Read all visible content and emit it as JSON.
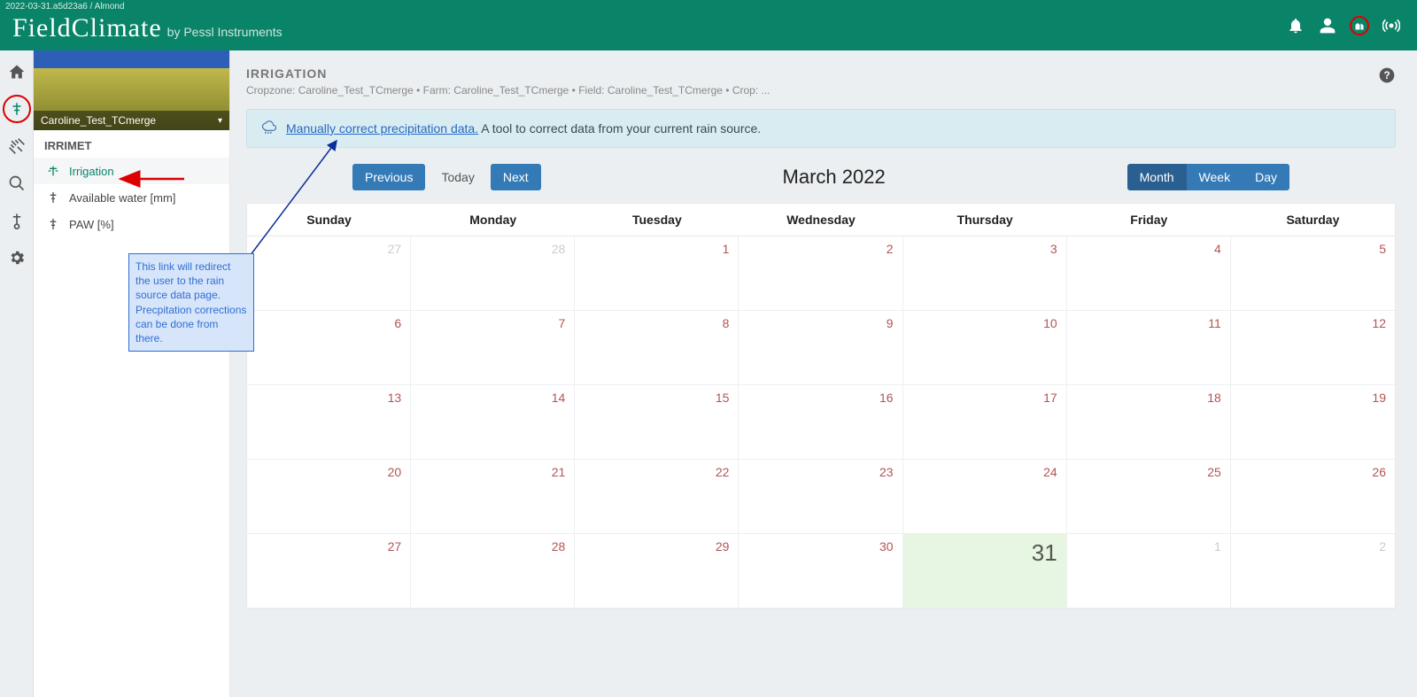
{
  "version": "2022-03-31.a5d23a6 / Almond",
  "brand": {
    "name": "FieldClimate",
    "by": "by Pessl Instruments"
  },
  "hero": {
    "title": "Caroline_Test_TCmerge"
  },
  "side_section": "IRRIMET",
  "side_items": [
    {
      "label": "Irrigation",
      "active": true
    },
    {
      "label": "Available water [mm]",
      "active": false
    },
    {
      "label": "PAW [%]",
      "active": false
    }
  ],
  "page": {
    "title": "IRRIGATION",
    "breadcrumb": "Cropzone: Caroline_Test_TCmerge • Farm: Caroline_Test_TCmerge • Field: Caroline_Test_TCmerge • Crop: ..."
  },
  "banner": {
    "link": "Manually correct precipitation data.",
    "rest": "A tool to correct data from your current rain source."
  },
  "nav": {
    "prev": "Previous",
    "today": "Today",
    "next": "Next"
  },
  "cal_title": "March 2022",
  "views": {
    "month": "Month",
    "week": "Week",
    "day": "Day"
  },
  "weekdays": [
    "Sunday",
    "Monday",
    "Tuesday",
    "Wednesday",
    "Thursday",
    "Friday",
    "Saturday"
  ],
  "cells": [
    {
      "n": "27",
      "cls": "out"
    },
    {
      "n": "28",
      "cls": "out"
    },
    {
      "n": "1",
      "cls": "in"
    },
    {
      "n": "2",
      "cls": "in"
    },
    {
      "n": "3",
      "cls": "in"
    },
    {
      "n": "4",
      "cls": "in"
    },
    {
      "n": "5",
      "cls": "in"
    },
    {
      "n": "6",
      "cls": "in"
    },
    {
      "n": "7",
      "cls": "in"
    },
    {
      "n": "8",
      "cls": "in"
    },
    {
      "n": "9",
      "cls": "in"
    },
    {
      "n": "10",
      "cls": "in"
    },
    {
      "n": "11",
      "cls": "in"
    },
    {
      "n": "12",
      "cls": "in"
    },
    {
      "n": "13",
      "cls": "in"
    },
    {
      "n": "14",
      "cls": "in"
    },
    {
      "n": "15",
      "cls": "in"
    },
    {
      "n": "16",
      "cls": "in"
    },
    {
      "n": "17",
      "cls": "in"
    },
    {
      "n": "18",
      "cls": "in"
    },
    {
      "n": "19",
      "cls": "in"
    },
    {
      "n": "20",
      "cls": "in"
    },
    {
      "n": "21",
      "cls": "in"
    },
    {
      "n": "22",
      "cls": "in"
    },
    {
      "n": "23",
      "cls": "in"
    },
    {
      "n": "24",
      "cls": "in"
    },
    {
      "n": "25",
      "cls": "in"
    },
    {
      "n": "26",
      "cls": "in"
    },
    {
      "n": "27",
      "cls": "in"
    },
    {
      "n": "28",
      "cls": "in"
    },
    {
      "n": "29",
      "cls": "in"
    },
    {
      "n": "30",
      "cls": "in"
    },
    {
      "n": "31",
      "cls": "in",
      "today": true
    },
    {
      "n": "1",
      "cls": "out"
    },
    {
      "n": "2",
      "cls": "out"
    }
  ],
  "annotation": "This link will redirect the user to the rain source data page. Precpitation corrections can be done from there."
}
